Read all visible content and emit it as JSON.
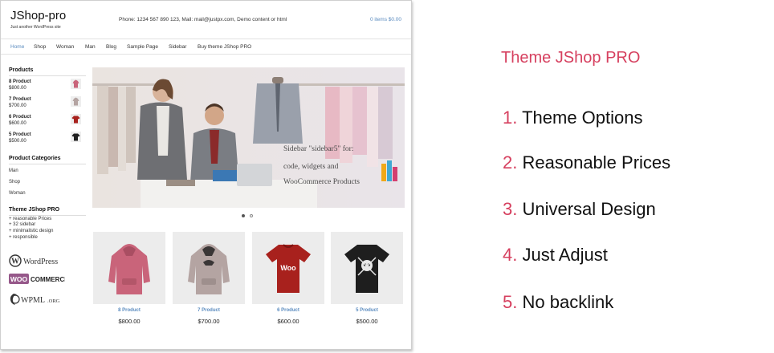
{
  "site": {
    "title": "JShop-pro",
    "tagline": "Just another WordPress site",
    "contact": "Phone: 1234 567 890 123, Mail: mail@justpx.com, Demo content or html",
    "cart": "0 items $0.00"
  },
  "nav": {
    "items": [
      "Home",
      "Shop",
      "Woman",
      "Man",
      "Blog",
      "Sample Page",
      "Sidebar",
      "Buy theme JShop PRO"
    ],
    "active": "Home"
  },
  "sidebar": {
    "products_heading": "Products",
    "products": [
      {
        "name": "8 Product",
        "price": "$800.00",
        "color": "#c9647a"
      },
      {
        "name": "7 Product",
        "price": "$700.00",
        "color": "#b4a4a2"
      },
      {
        "name": "6 Product",
        "price": "$600.00",
        "color": "#a8211d"
      },
      {
        "name": "5 Product",
        "price": "$500.00",
        "color": "#1e1e1e"
      }
    ],
    "categories_heading": "Product Categories",
    "categories": [
      "Man",
      "Shop",
      "Woman"
    ],
    "theme_heading": "Theme JShop PRO",
    "theme_features": [
      "+ reasonable Prices",
      "+ 32 sidebar",
      "+ minimalistic design",
      "+ responsible"
    ],
    "logos": {
      "wordpress": "WordPress",
      "woo_left": "WOO",
      "woo_right": "COMMERCE",
      "wpml": "WPML",
      "wpml_suffix": ".ORG"
    }
  },
  "banner": {
    "text_lines": [
      "Sidebar \"sidebar5\" for:",
      "code, widgets and",
      "WooCommerce Products"
    ]
  },
  "products": [
    {
      "name": "8 Product",
      "price": "$800.00",
      "color": "#c9647a",
      "type": "hoodie"
    },
    {
      "name": "7 Product",
      "price": "$700.00",
      "color": "#b4a4a2",
      "type": "hoodie"
    },
    {
      "name": "6 Product",
      "price": "$600.00",
      "color": "#a8211d",
      "type": "tshirt",
      "print": "Woo"
    },
    {
      "name": "5 Product",
      "price": "$500.00",
      "color": "#1e1e1e",
      "type": "tshirt"
    }
  ],
  "promo": {
    "title": "Theme JShop PRO",
    "items": [
      {
        "num": "1.",
        "text": "Theme Options"
      },
      {
        "num": "2.",
        "text": "Reasonable Prices"
      },
      {
        "num": "3.",
        "text": "Universal Design"
      },
      {
        "num": "4.",
        "text": "Just Adjust"
      },
      {
        "num": "5.",
        "text": "No backlink"
      }
    ]
  },
  "colors": {
    "accent": "#d6405f",
    "link": "#5a8bbf"
  }
}
